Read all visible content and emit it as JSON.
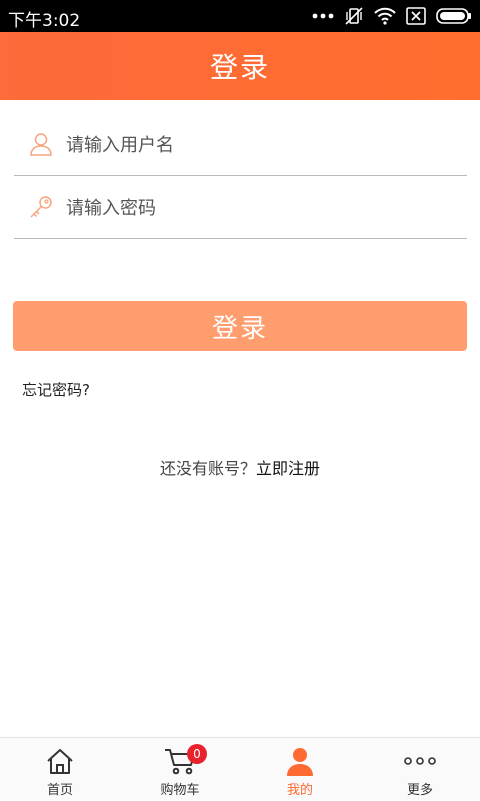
{
  "status_bar": {
    "time": "下午3:02"
  },
  "header": {
    "title": "登录"
  },
  "form": {
    "username_placeholder": "请输入用户名",
    "password_placeholder": "请输入密码",
    "login_label": "登录",
    "forgot_label": "忘记密码?"
  },
  "register": {
    "prompt": "还没有账号？",
    "link_label": "立即注册"
  },
  "tabs": [
    {
      "label": "首页",
      "icon": "home-icon"
    },
    {
      "label": "购物车",
      "icon": "cart-icon",
      "badge": "0"
    },
    {
      "label": "我的",
      "icon": "user-icon",
      "active": true
    },
    {
      "label": "更多",
      "icon": "more-icon"
    }
  ],
  "colors": {
    "accent": "#ff6a32",
    "button": "#ff9d6e",
    "badge": "#e8222b"
  }
}
